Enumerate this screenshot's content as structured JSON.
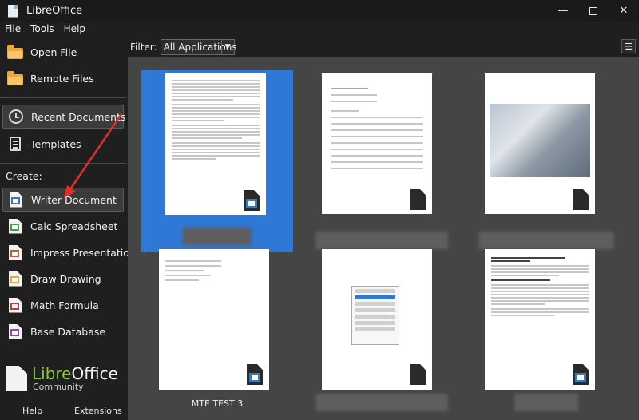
{
  "window": {
    "title": "LibreOffice",
    "minimize_icon": "minimize-icon",
    "maximize_icon": "maximize-icon",
    "close_icon": "close-icon"
  },
  "menu": [
    {
      "label": "File"
    },
    {
      "label": "Tools"
    },
    {
      "label": "Help"
    }
  ],
  "sidebar": {
    "open_file": "Open File",
    "remote_files": "Remote Files",
    "recent_documents": "Recent Documents",
    "templates": "Templates",
    "create_label": "Create:",
    "create_items": [
      {
        "label": "Writer Document",
        "color": "#3a79b8"
      },
      {
        "label": "Calc Spreadsheet",
        "color": "#3fa34d"
      },
      {
        "label": "Impress Presentation",
        "color": "#d2533a"
      },
      {
        "label": "Draw Drawing",
        "color": "#e5a83a"
      },
      {
        "label": "Math Formula",
        "color": "#c43b3b"
      },
      {
        "label": "Base Database",
        "color": "#8e4fa3"
      }
    ],
    "logo_word_1": "Libre",
    "logo_word_2": "Office",
    "logo_sub": "Community",
    "help_button": "Help",
    "extensions_button": "Extensions"
  },
  "filter": {
    "label": "Filter:",
    "value": "All Applications"
  },
  "recent_docs": [
    {
      "caption": "",
      "selected": true
    },
    {
      "caption": "",
      "selected": false
    },
    {
      "caption": "",
      "selected": false
    },
    {
      "caption": "",
      "selected": false
    },
    {
      "caption": "MTE TEST 3",
      "selected": false
    },
    {
      "caption": "",
      "selected": false
    }
  ],
  "colors": {
    "accent": "#2f78d6",
    "annotation_arrow": "#e0302b",
    "writer_blue": "#3a79b8"
  }
}
